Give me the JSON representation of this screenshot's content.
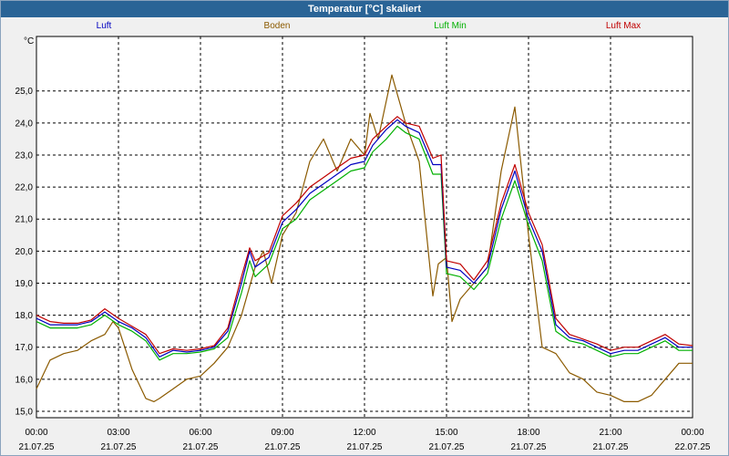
{
  "window": {
    "title": "Temperatur [°C] skaliert"
  },
  "colors": {
    "background": "#ffffff",
    "grid": "#000000",
    "luft": "#0000c0",
    "boden": "#8b5a00",
    "luft_min": "#00b000",
    "luft_max": "#c00000"
  },
  "chart_data": {
    "type": "line",
    "title": "Temperatur [°C] skaliert",
    "ylabel": "°C",
    "xlabel": "",
    "ylim": [
      14.8,
      26.7
    ],
    "xlim": [
      0,
      24
    ],
    "grid": true,
    "legend_position": "top",
    "yticks": [
      "25,0",
      "24,0",
      "23,0",
      "22,0",
      "21,0",
      "20,0",
      "19,0",
      "18,0",
      "17,0",
      "16,0",
      "15,0"
    ],
    "ytick_values": [
      25,
      24,
      23,
      22,
      21,
      20,
      19,
      18,
      17,
      16,
      15
    ],
    "xtick_values": [
      0,
      3,
      6,
      9,
      12,
      15,
      18,
      21,
      24
    ],
    "xticks": [
      {
        "time": "00:00",
        "date": "21.07.25"
      },
      {
        "time": "03:00",
        "date": "21.07.25"
      },
      {
        "time": "06:00",
        "date": "21.07.25"
      },
      {
        "time": "09:00",
        "date": "21.07.25"
      },
      {
        "time": "12:00",
        "date": "21.07.25"
      },
      {
        "time": "15:00",
        "date": "21.07.25"
      },
      {
        "time": "18:00",
        "date": "21.07.25"
      },
      {
        "time": "21:00",
        "date": "21.07.25"
      },
      {
        "time": "00:00",
        "date": "22.07.25"
      }
    ],
    "series": [
      {
        "name": "Luft",
        "color": "#0000c0",
        "x": [
          0,
          0.5,
          1,
          1.5,
          2,
          2.5,
          3,
          3.5,
          4,
          4.5,
          5,
          5.5,
          6,
          6.5,
          7,
          7.5,
          7.8,
          8,
          8.5,
          9,
          9.5,
          10,
          10.5,
          11,
          11.5,
          12,
          12.3,
          12.8,
          13.2,
          13.5,
          14,
          14.5,
          14.8,
          15,
          15.5,
          16,
          16.5,
          17,
          17.5,
          18,
          18.5,
          19,
          19.5,
          20,
          20.5,
          21,
          21.5,
          22,
          22.5,
          23,
          23.5,
          24
        ],
        "y": [
          17.9,
          17.7,
          17.7,
          17.7,
          17.8,
          18.1,
          17.8,
          17.6,
          17.3,
          16.7,
          16.9,
          16.85,
          16.9,
          17.0,
          17.5,
          19.0,
          20.0,
          19.5,
          19.8,
          20.9,
          21.3,
          21.8,
          22.1,
          22.4,
          22.7,
          22.8,
          23.3,
          23.8,
          24.1,
          23.9,
          23.7,
          22.7,
          22.7,
          19.5,
          19.4,
          19.0,
          19.5,
          21.3,
          22.5,
          21.0,
          20.0,
          17.7,
          17.3,
          17.2,
          17.0,
          16.8,
          16.9,
          16.9,
          17.1,
          17.3,
          17.0,
          17.0
        ]
      },
      {
        "name": "Boden",
        "color": "#8b5a00",
        "x": [
          0,
          0.5,
          1,
          1.5,
          2,
          2.5,
          2.8,
          3,
          3.5,
          4,
          4.3,
          4.5,
          5,
          5.5,
          6,
          6.5,
          7,
          7.5,
          8,
          8.3,
          8.6,
          9,
          9.5,
          10,
          10.5,
          11,
          11.5,
          12,
          12.2,
          12.5,
          13,
          13.5,
          14,
          14.5,
          14.7,
          15,
          15.2,
          15.5,
          16,
          16.5,
          17,
          17.5,
          18,
          18.5,
          19,
          19.5,
          20,
          20.5,
          21,
          21.5,
          22,
          22.5,
          23,
          23.5,
          24
        ],
        "y": [
          15.7,
          16.6,
          16.8,
          16.9,
          17.2,
          17.4,
          17.8,
          17.6,
          16.3,
          15.4,
          15.3,
          15.4,
          15.7,
          16.0,
          16.1,
          16.5,
          17.0,
          18.0,
          19.5,
          20.0,
          19.0,
          20.5,
          21.2,
          22.8,
          23.5,
          22.5,
          23.5,
          23.0,
          24.3,
          23.5,
          25.5,
          24.0,
          22.8,
          18.6,
          19.6,
          19.8,
          17.8,
          18.5,
          19.0,
          19.5,
          22.5,
          24.5,
          20.5,
          17.0,
          16.8,
          16.2,
          16.0,
          15.6,
          15.5,
          15.3,
          15.3,
          15.5,
          16.0,
          16.5,
          16.5
        ]
      },
      {
        "name": "Luft Min",
        "color": "#00b000",
        "x": [
          0,
          0.5,
          1,
          1.5,
          2,
          2.5,
          3,
          3.5,
          4,
          4.5,
          5,
          5.5,
          6,
          6.5,
          7,
          7.5,
          7.8,
          8,
          8.5,
          9,
          9.5,
          10,
          10.5,
          11,
          11.5,
          12,
          12.3,
          12.8,
          13.2,
          13.5,
          14,
          14.5,
          14.8,
          15,
          15.5,
          16,
          16.5,
          17,
          17.5,
          18,
          18.5,
          19,
          19.5,
          20,
          20.5,
          21,
          21.5,
          22,
          22.5,
          23,
          23.5,
          24
        ],
        "y": [
          17.8,
          17.6,
          17.6,
          17.6,
          17.7,
          18.0,
          17.7,
          17.5,
          17.2,
          16.6,
          16.8,
          16.8,
          16.85,
          16.95,
          17.3,
          18.7,
          19.7,
          19.2,
          19.6,
          20.7,
          21.0,
          21.6,
          21.9,
          22.2,
          22.5,
          22.6,
          23.1,
          23.5,
          23.9,
          23.7,
          23.5,
          22.4,
          22.4,
          19.3,
          19.2,
          18.8,
          19.3,
          21.0,
          22.2,
          20.8,
          19.7,
          17.5,
          17.2,
          17.1,
          16.9,
          16.7,
          16.8,
          16.8,
          17.0,
          17.2,
          16.9,
          16.9
        ]
      },
      {
        "name": "Luft Max",
        "color": "#c00000",
        "x": [
          0,
          0.5,
          1,
          1.5,
          2,
          2.5,
          3,
          3.5,
          4,
          4.5,
          5,
          5.5,
          6,
          6.5,
          7,
          7.5,
          7.8,
          8,
          8.5,
          9,
          9.5,
          10,
          10.5,
          11,
          11.5,
          12,
          12.3,
          12.8,
          13.2,
          13.5,
          14,
          14.5,
          14.8,
          15,
          15.5,
          16,
          16.5,
          17,
          17.5,
          18,
          18.5,
          19,
          19.5,
          20,
          20.5,
          21,
          21.5,
          22,
          22.5,
          23,
          23.5,
          24
        ],
        "y": [
          18.0,
          17.8,
          17.75,
          17.75,
          17.85,
          18.2,
          17.9,
          17.65,
          17.4,
          16.8,
          16.95,
          16.9,
          16.95,
          17.05,
          17.6,
          19.2,
          20.1,
          19.7,
          19.95,
          21.1,
          21.5,
          22.0,
          22.3,
          22.6,
          22.9,
          23.0,
          23.5,
          23.9,
          24.2,
          24.0,
          23.9,
          22.9,
          23.0,
          19.7,
          19.6,
          19.1,
          19.7,
          21.5,
          22.7,
          21.2,
          20.2,
          17.9,
          17.4,
          17.25,
          17.1,
          16.9,
          17.0,
          17.0,
          17.2,
          17.4,
          17.1,
          17.05
        ]
      }
    ]
  }
}
